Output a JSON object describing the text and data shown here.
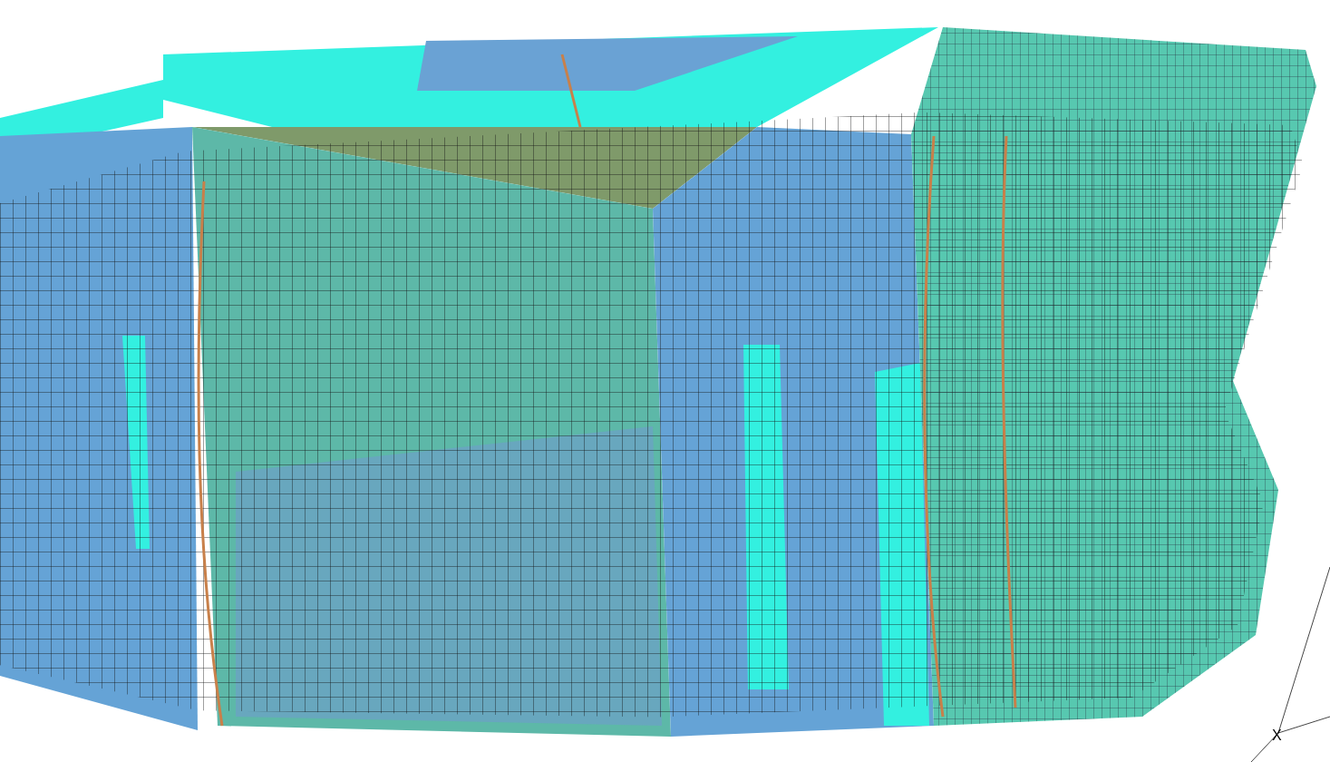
{
  "viewport": {
    "axis_label": "X"
  }
}
